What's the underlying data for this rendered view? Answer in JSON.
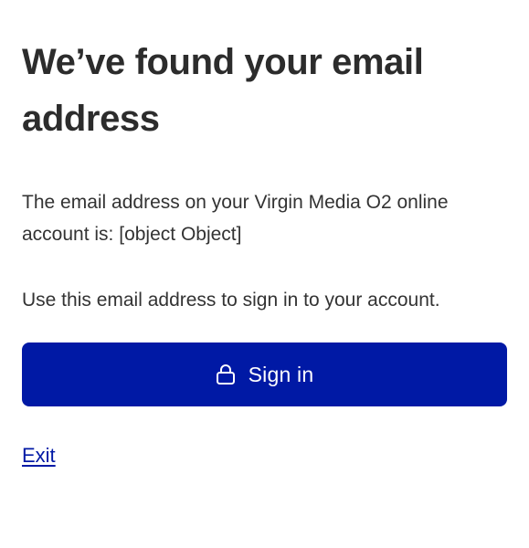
{
  "heading": {
    "title": "We’ve found your email address"
  },
  "body": {
    "paragraph_prefix": "The email address on your Virgin Media O2 online account is: ",
    "email_value": "[object Object]",
    "paragraph_2": "Use this email address to sign in to your account."
  },
  "actions": {
    "sign_in_label": "Sign in",
    "sign_in_icon": "lock-icon",
    "exit_label": "Exit"
  },
  "colors": {
    "primary": "#0019a5",
    "text": "#2f2f2f",
    "background": "#ffffff"
  }
}
